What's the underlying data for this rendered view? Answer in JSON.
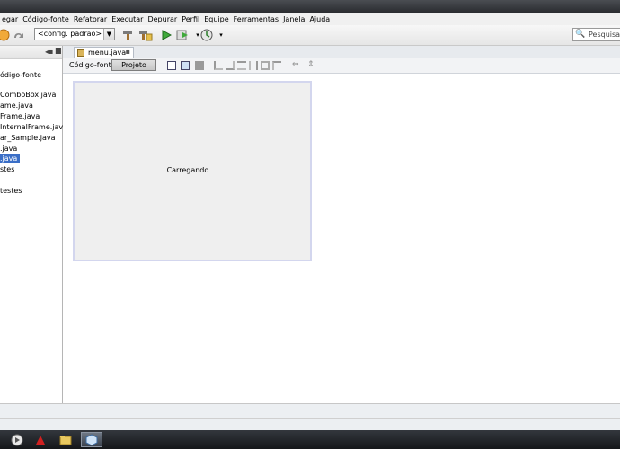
{
  "menubar": {
    "items": [
      "egar",
      "Código-fonte",
      "Refatorar",
      "Executar",
      "Depurar",
      "Perfil",
      "Equipe",
      "Ferramentas",
      "Janela",
      "Ajuda"
    ]
  },
  "toolbar": {
    "config_value": "<config. padrão>",
    "search_placeholder": "Pesquisar"
  },
  "project_tree": {
    "items": [
      {
        "label": "ódigo-fonte",
        "selected": false
      },
      {
        "label": "ComboBox.java",
        "selected": false
      },
      {
        "label": "ame.java",
        "selected": false
      },
      {
        "label": "Frame.java",
        "selected": false
      },
      {
        "label": "InternalFrame.java",
        "selected": false
      },
      {
        "label": "ar_Sample.java",
        "selected": false
      },
      {
        "label": ".java",
        "selected": false
      },
      {
        "label": ".java",
        "selected": true
      },
      {
        "label": "stes",
        "selected": false
      },
      {
        "label": " testes",
        "selected": false
      }
    ]
  },
  "editor": {
    "tab_label": "menu.java",
    "source_label": "Código-fonte",
    "design_label": "Projeto",
    "loading_text": "Carregando ..."
  },
  "colors": {
    "selection": "#3b6fc7",
    "form_border": "#d3d6ee"
  }
}
